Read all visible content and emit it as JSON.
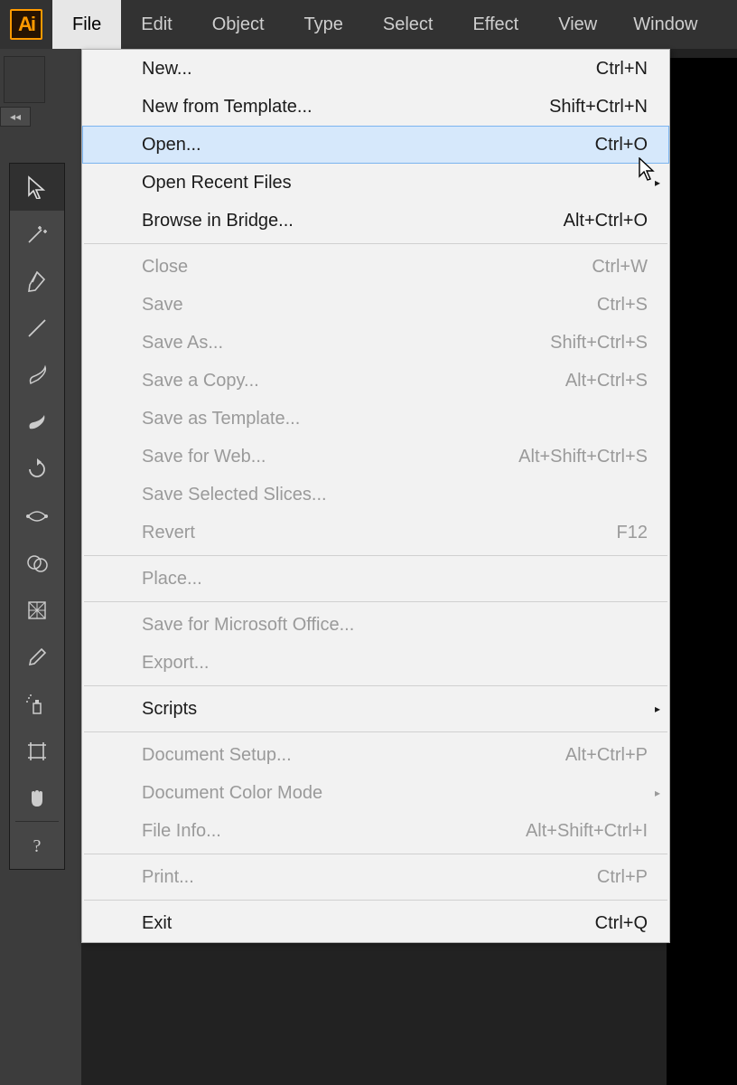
{
  "app": {
    "logo_text": "Ai"
  },
  "menubar": {
    "items": [
      {
        "label": "File",
        "open": true
      },
      {
        "label": "Edit",
        "open": false
      },
      {
        "label": "Object",
        "open": false
      },
      {
        "label": "Type",
        "open": false
      },
      {
        "label": "Select",
        "open": false
      },
      {
        "label": "Effect",
        "open": false
      },
      {
        "label": "View",
        "open": false
      },
      {
        "label": "Window",
        "open": false
      }
    ]
  },
  "toolbox": {
    "tools": [
      {
        "name": "selection-tool",
        "icon": "cursor"
      },
      {
        "name": "magic-wand-tool",
        "icon": "wand"
      },
      {
        "name": "pen-tool",
        "icon": "pen"
      },
      {
        "name": "line-segment-tool",
        "icon": "line"
      },
      {
        "name": "paintbrush-tool",
        "icon": "brush"
      },
      {
        "name": "blob-brush-tool",
        "icon": "blob"
      },
      {
        "name": "rotate-tool",
        "icon": "rotate"
      },
      {
        "name": "width-tool",
        "icon": "width"
      },
      {
        "name": "shape-builder-tool",
        "icon": "shapebuilder"
      },
      {
        "name": "mesh-tool",
        "icon": "mesh"
      },
      {
        "name": "eyedropper-tool",
        "icon": "eyedropper"
      },
      {
        "name": "symbol-sprayer-tool",
        "icon": "spray"
      },
      {
        "name": "artboard-tool",
        "icon": "artboard"
      },
      {
        "name": "hand-tool",
        "icon": "hand"
      },
      {
        "name": "help-tool",
        "icon": "help"
      }
    ]
  },
  "file_menu": {
    "groups": [
      [
        {
          "label": "New...",
          "shortcut": "Ctrl+N",
          "disabled": false,
          "highlight": false,
          "submenu": false
        },
        {
          "label": "New from Template...",
          "shortcut": "Shift+Ctrl+N",
          "disabled": false,
          "highlight": false,
          "submenu": false
        },
        {
          "label": "Open...",
          "shortcut": "Ctrl+O",
          "disabled": false,
          "highlight": true,
          "submenu": false
        },
        {
          "label": "Open Recent Files",
          "shortcut": "",
          "disabled": false,
          "highlight": false,
          "submenu": true
        },
        {
          "label": "Browse in Bridge...",
          "shortcut": "Alt+Ctrl+O",
          "disabled": false,
          "highlight": false,
          "submenu": false
        }
      ],
      [
        {
          "label": "Close",
          "shortcut": "Ctrl+W",
          "disabled": true
        },
        {
          "label": "Save",
          "shortcut": "Ctrl+S",
          "disabled": true
        },
        {
          "label": "Save As...",
          "shortcut": "Shift+Ctrl+S",
          "disabled": true
        },
        {
          "label": "Save a Copy...",
          "shortcut": "Alt+Ctrl+S",
          "disabled": true
        },
        {
          "label": "Save as Template...",
          "shortcut": "",
          "disabled": true
        },
        {
          "label": "Save for Web...",
          "shortcut": "Alt+Shift+Ctrl+S",
          "disabled": true
        },
        {
          "label": "Save Selected Slices...",
          "shortcut": "",
          "disabled": true
        },
        {
          "label": "Revert",
          "shortcut": "F12",
          "disabled": true
        }
      ],
      [
        {
          "label": "Place...",
          "shortcut": "",
          "disabled": true
        }
      ],
      [
        {
          "label": "Save for Microsoft Office...",
          "shortcut": "",
          "disabled": true
        },
        {
          "label": "Export...",
          "shortcut": "",
          "disabled": true
        }
      ],
      [
        {
          "label": "Scripts",
          "shortcut": "",
          "disabled": false,
          "submenu": true
        }
      ],
      [
        {
          "label": "Document Setup...",
          "shortcut": "Alt+Ctrl+P",
          "disabled": true
        },
        {
          "label": "Document Color Mode",
          "shortcut": "",
          "disabled": true,
          "submenu": true
        },
        {
          "label": "File Info...",
          "shortcut": "Alt+Shift+Ctrl+I",
          "disabled": true
        }
      ],
      [
        {
          "label": "Print...",
          "shortcut": "Ctrl+P",
          "disabled": true
        }
      ],
      [
        {
          "label": "Exit",
          "shortcut": "Ctrl+Q",
          "disabled": false
        }
      ]
    ]
  }
}
